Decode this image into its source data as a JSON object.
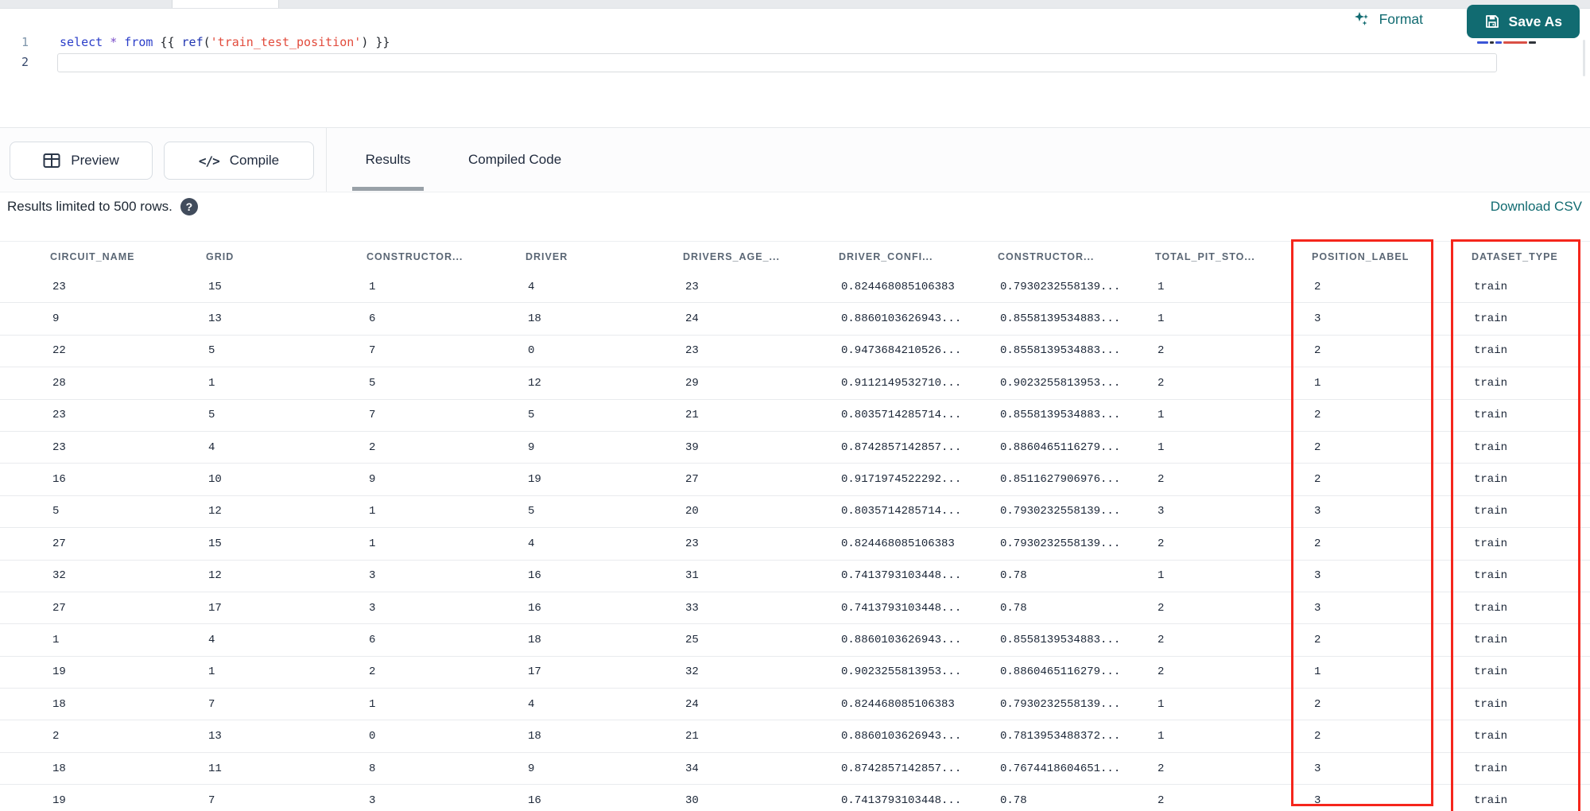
{
  "colors": {
    "accent_teal": "#116B71",
    "annotation_red": "#F5261C",
    "header_text": "#5B6775",
    "cell_text": "#1B2637",
    "keyword_blue": "#2B3EC9",
    "string_red": "#E24B3C",
    "tab_underline": "#99A1A8"
  },
  "toolbar": {
    "format_label": "Format",
    "save_as_label": "Save As"
  },
  "editor": {
    "line1_number": "1",
    "line2_number": "2",
    "code_tokens": [
      {
        "text": "select",
        "type": "keyword"
      },
      {
        "text": " ",
        "type": "plain"
      },
      {
        "text": "*",
        "type": "operator"
      },
      {
        "text": " ",
        "type": "plain"
      },
      {
        "text": "from",
        "type": "keyword"
      },
      {
        "text": " ",
        "type": "plain"
      },
      {
        "text": "{{",
        "type": "brace"
      },
      {
        "text": " ",
        "type": "plain"
      },
      {
        "text": "ref",
        "type": "function"
      },
      {
        "text": "(",
        "type": "paren"
      },
      {
        "text": "'train_test_position'",
        "type": "string"
      },
      {
        "text": ")",
        "type": "paren"
      },
      {
        "text": " ",
        "type": "plain"
      },
      {
        "text": "}}",
        "type": "brace"
      }
    ]
  },
  "actions": {
    "preview_label": "Preview",
    "compile_label": "Compile"
  },
  "tabs": [
    {
      "label": "Results",
      "active": true
    },
    {
      "label": "Compiled Code",
      "active": false
    }
  ],
  "results": {
    "limit_note": "Results limited to 500 rows.",
    "help_glyph": "?",
    "download_label": "Download CSV",
    "table": {
      "columns": [
        "CIRCUIT_NAME",
        "GRID",
        "CONSTRUCTOR...",
        "DRIVER",
        "DRIVERS_AGE_...",
        "DRIVER_CONFI...",
        "CONSTRUCTOR...",
        "TOTAL_PIT_STO...",
        "POSITION_LABEL",
        "DATASET_TYPE"
      ],
      "highlighted_columns": [
        "POSITION_LABEL",
        "DATASET_TYPE"
      ],
      "rows": [
        [
          "23",
          "15",
          "1",
          "4",
          "23",
          "0.824468085106383",
          "0.7930232558139...",
          "1",
          "2",
          "train"
        ],
        [
          "9",
          "13",
          "6",
          "18",
          "24",
          "0.8860103626943...",
          "0.8558139534883...",
          "1",
          "3",
          "train"
        ],
        [
          "22",
          "5",
          "7",
          "0",
          "23",
          "0.9473684210526...",
          "0.8558139534883...",
          "2",
          "2",
          "train"
        ],
        [
          "28",
          "1",
          "5",
          "12",
          "29",
          "0.9112149532710...",
          "0.9023255813953...",
          "2",
          "1",
          "train"
        ],
        [
          "23",
          "5",
          "7",
          "5",
          "21",
          "0.8035714285714...",
          "0.8558139534883...",
          "1",
          "2",
          "train"
        ],
        [
          "23",
          "4",
          "2",
          "9",
          "39",
          "0.8742857142857...",
          "0.8860465116279...",
          "1",
          "2",
          "train"
        ],
        [
          "16",
          "10",
          "9",
          "19",
          "27",
          "0.9171974522292...",
          "0.8511627906976...",
          "2",
          "2",
          "train"
        ],
        [
          "5",
          "12",
          "1",
          "5",
          "20",
          "0.8035714285714...",
          "0.7930232558139...",
          "3",
          "3",
          "train"
        ],
        [
          "27",
          "15",
          "1",
          "4",
          "23",
          "0.824468085106383",
          "0.7930232558139...",
          "2",
          "2",
          "train"
        ],
        [
          "32",
          "12",
          "3",
          "16",
          "31",
          "0.7413793103448...",
          "0.78",
          "1",
          "3",
          "train"
        ],
        [
          "27",
          "17",
          "3",
          "16",
          "33",
          "0.7413793103448...",
          "0.78",
          "2",
          "3",
          "train"
        ],
        [
          "1",
          "4",
          "6",
          "18",
          "25",
          "0.8860103626943...",
          "0.8558139534883...",
          "2",
          "2",
          "train"
        ],
        [
          "19",
          "1",
          "2",
          "17",
          "32",
          "0.9023255813953...",
          "0.8860465116279...",
          "2",
          "1",
          "train"
        ],
        [
          "18",
          "7",
          "1",
          "4",
          "24",
          "0.824468085106383",
          "0.7930232558139...",
          "1",
          "2",
          "train"
        ],
        [
          "2",
          "13",
          "0",
          "18",
          "21",
          "0.8860103626943...",
          "0.7813953488372...",
          "1",
          "2",
          "train"
        ],
        [
          "18",
          "11",
          "8",
          "9",
          "34",
          "0.8742857142857...",
          "0.7674418604651...",
          "2",
          "3",
          "train"
        ],
        [
          "19",
          "7",
          "3",
          "16",
          "30",
          "0.7413793103448...",
          "0.78",
          "2",
          "3",
          "train"
        ]
      ]
    }
  }
}
